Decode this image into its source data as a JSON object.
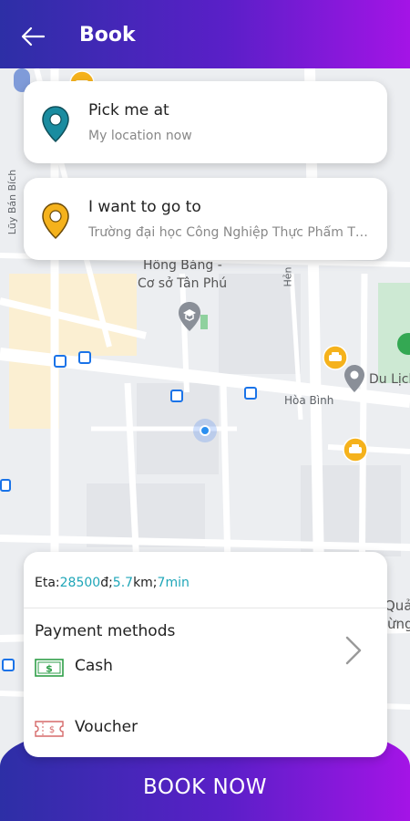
{
  "header": {
    "title": "Book",
    "back_icon": "arrow-left-icon"
  },
  "pickup": {
    "label": "Pick me at",
    "value": "My location now",
    "icon": "location-pin-icon",
    "color": "#1a8ca0"
  },
  "destination": {
    "label": "I want to go to",
    "value": "Trường đại học Công Nghiệp Thực Phẩm Thành phố Hồ Chí Minh",
    "icon": "location-pin-icon",
    "color": "#f5b21c"
  },
  "map": {
    "labels": {
      "hong_bang": "Hồng Bàng -",
      "co_so": "Cơ sở Tân Phú",
      "hoa_binh": "Hòa Bình",
      "du_lich": "Du Lịch",
      "luy_ban_bich": "Lũy Bán Bích",
      "quan": "Quả",
      "rung": "ừng",
      "hen": "Hẻn"
    }
  },
  "trip": {
    "eta_prefix": "Eta:",
    "price": "28500",
    "currency": "đ;",
    "distance": "5.7",
    "distance_unit": "km;",
    "duration": "7min"
  },
  "payment": {
    "title": "Payment methods",
    "methods": [
      {
        "label": "Cash",
        "icon": "cash-icon"
      },
      {
        "label": "Voucher",
        "icon": "voucher-icon"
      }
    ]
  },
  "book_button": {
    "label": "BOOK NOW"
  },
  "colors": {
    "accent": "#1fa6b8",
    "gradient_start": "#2d2fa6",
    "gradient_end": "#a414e6"
  }
}
